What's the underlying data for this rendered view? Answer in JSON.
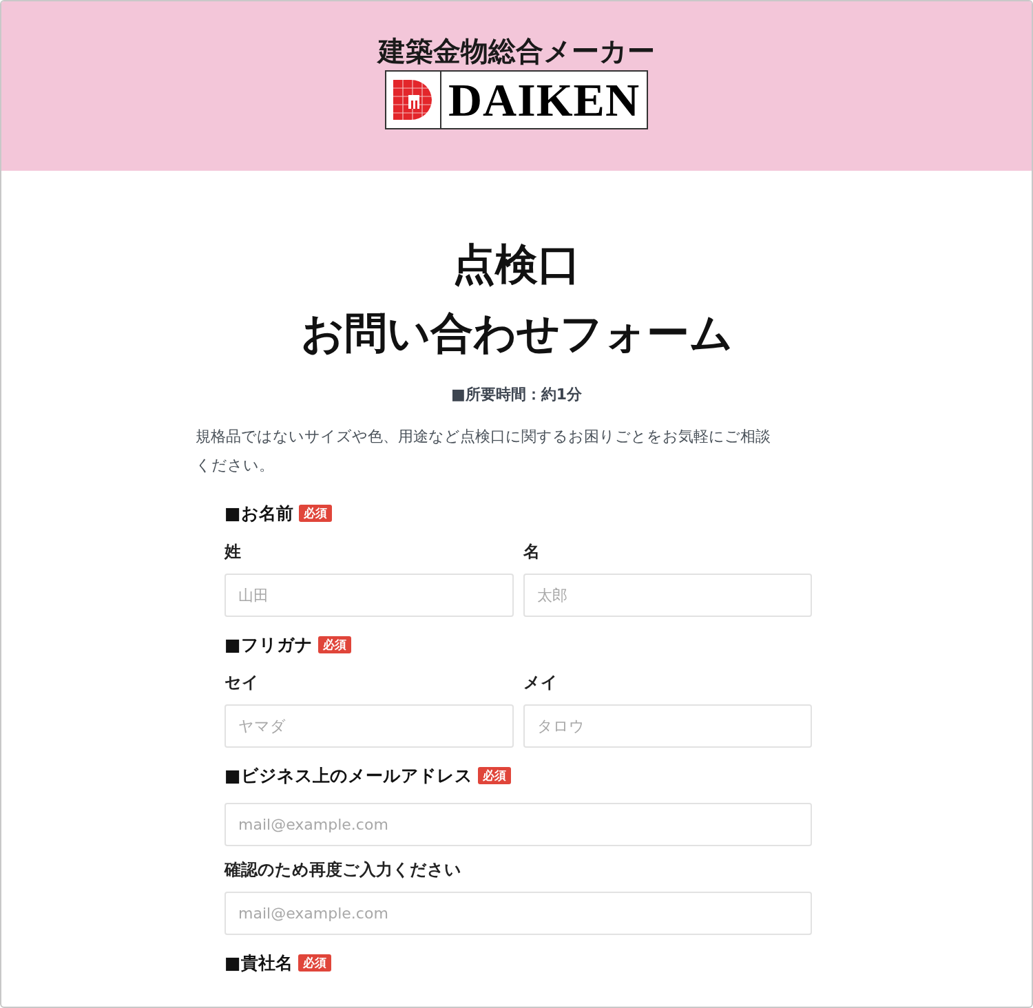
{
  "header": {
    "tagline": "建築金物総合メーカー",
    "brand": "DAIKEN"
  },
  "title_lines": [
    "点検口",
    "お問い合わせフォーム"
  ],
  "duration": "■所要時間：約1分",
  "intro": "規格品ではないサイズや色、用途など点検口に関するお困りごとをお気軽にご相談ください。",
  "sections": [
    {
      "kind": "pair",
      "label": "■お名前",
      "badge": "必須",
      "fields": [
        {
          "label": "姓",
          "placeholder": "山田"
        },
        {
          "label": "名",
          "placeholder": "太郎"
        }
      ]
    },
    {
      "kind": "pair",
      "label": "■フリガナ",
      "badge": "必須",
      "fields": [
        {
          "label": "セイ",
          "placeholder": "ヤマダ"
        },
        {
          "label": "メイ",
          "placeholder": "タロウ"
        }
      ]
    },
    {
      "kind": "stack",
      "label": "■ビジネス上のメールアドレス",
      "badge": "必須",
      "fields": [
        {
          "placeholder": "mail@example.com"
        },
        {
          "label": "確認のため再度ご入力ください",
          "placeholder": "mail@example.com"
        }
      ]
    },
    {
      "kind": "stack",
      "label": "■貴社名",
      "badge": "必須"
    }
  ]
}
